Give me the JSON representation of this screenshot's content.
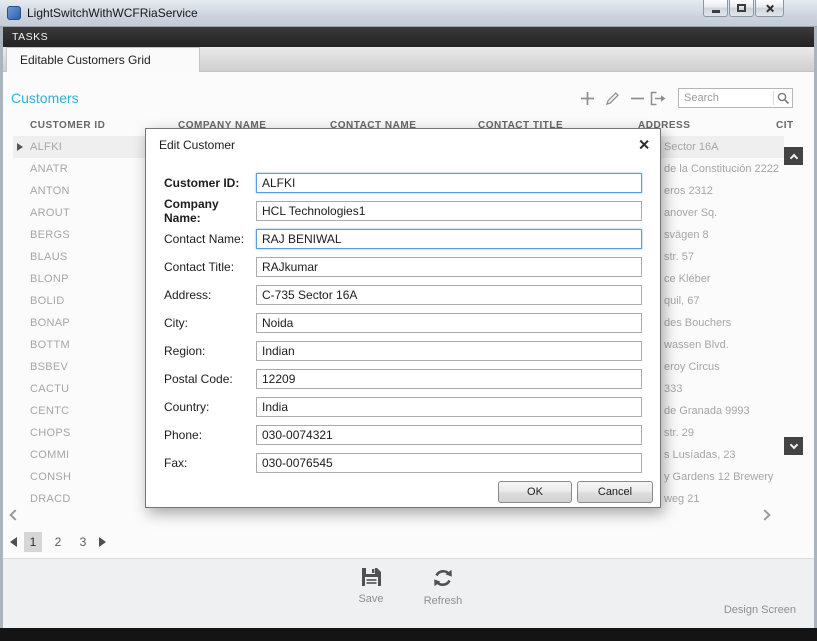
{
  "window": {
    "title": "LightSwitchWithWCFRiaService"
  },
  "menu": {
    "tasks": "TASKS"
  },
  "tabs": {
    "active": "Editable Customers Grid"
  },
  "screen": {
    "title": "Customers",
    "search_placeholder": "Search"
  },
  "grid": {
    "columns": [
      "CUSTOMER ID",
      "COMPANY NAME",
      "CONTACT NAME",
      "CONTACT TITLE",
      "ADDRESS",
      "CIT"
    ],
    "rows": [
      {
        "customer_id": "ALFKI",
        "address_fragment": "Sector 16A",
        "selected": true
      },
      {
        "customer_id": "ANATR",
        "address_fragment": "de la Constitución 2222",
        "selected": false
      },
      {
        "customer_id": "ANTON",
        "address_fragment": "eros  2312",
        "selected": false
      },
      {
        "customer_id": "AROUT",
        "address_fragment": "anover Sq.",
        "selected": false
      },
      {
        "customer_id": "BERGS",
        "address_fragment": "svägen  8",
        "selected": false
      },
      {
        "customer_id": "BLAUS",
        "address_fragment": "str. 57",
        "selected": false
      },
      {
        "customer_id": "BLONP",
        "address_fragment": "ce Kléber",
        "selected": false
      },
      {
        "customer_id": "BOLID",
        "address_fragment": "quil, 67",
        "selected": false
      },
      {
        "customer_id": "BONAP",
        "address_fragment": "des Bouchers",
        "selected": false
      },
      {
        "customer_id": "BOTTM",
        "address_fragment": "wassen Blvd.",
        "selected": false
      },
      {
        "customer_id": "BSBEV",
        "address_fragment": "eroy Circus",
        "selected": false
      },
      {
        "customer_id": "CACTU",
        "address_fragment": "333",
        "selected": false
      },
      {
        "customer_id": "CENTC",
        "address_fragment": "de Granada 9993",
        "selected": false
      },
      {
        "customer_id": "CHOPS",
        "address_fragment": "str. 29",
        "selected": false
      },
      {
        "customer_id": "COMMI",
        "address_fragment": "s Lusíadas, 23",
        "selected": false
      },
      {
        "customer_id": "CONSH",
        "address_fragment": "y Gardens 12  Brewery",
        "selected": false
      },
      {
        "customer_id": "DRACD",
        "address_fragment": "weg 21",
        "selected": false
      }
    ]
  },
  "pagination": {
    "pages": [
      "1",
      "2",
      "3"
    ],
    "current": "1"
  },
  "command_bar": {
    "save": "Save",
    "refresh": "Refresh"
  },
  "footer": {
    "design_screen": "Design Screen"
  },
  "dialog": {
    "title": "Edit Customer",
    "fields": [
      {
        "label": "Customer ID:",
        "value": "ALFKI",
        "bold": true,
        "focused": true
      },
      {
        "label": "Company Name:",
        "value": "HCL Technologies1",
        "bold": true,
        "focused": false
      },
      {
        "label": "Contact Name:",
        "value": "RAJ BENIWAL",
        "bold": false,
        "focused": true
      },
      {
        "label": "Contact Title:",
        "value": "RAJkumar",
        "bold": false,
        "focused": false
      },
      {
        "label": "Address:",
        "value": "C-735 Sector 16A",
        "bold": false,
        "focused": false
      },
      {
        "label": "City:",
        "value": "Noida",
        "bold": false,
        "focused": false
      },
      {
        "label": "Region:",
        "value": "Indian",
        "bold": false,
        "focused": false
      },
      {
        "label": "Postal Code:",
        "value": "12209",
        "bold": false,
        "focused": false
      },
      {
        "label": "Country:",
        "value": "India",
        "bold": false,
        "focused": false
      },
      {
        "label": "Phone:",
        "value": "030-0074321",
        "bold": false,
        "focused": false
      },
      {
        "label": "Fax:",
        "value": "030-0076545",
        "bold": false,
        "focused": false
      }
    ],
    "buttons": {
      "ok": "OK",
      "cancel": "Cancel"
    }
  }
}
